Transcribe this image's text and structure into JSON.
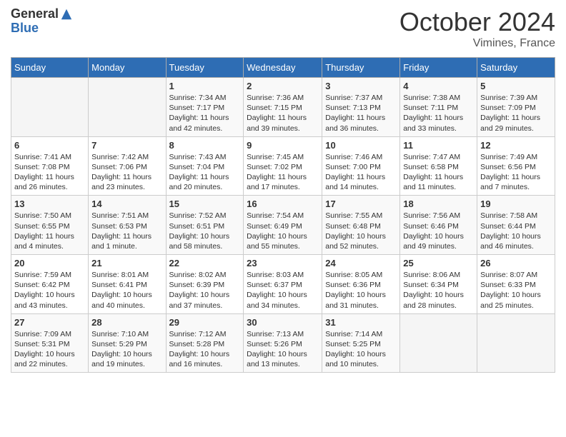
{
  "logo": {
    "general": "General",
    "blue": "Blue"
  },
  "title": "October 2024",
  "location": "Vimines, France",
  "weekdays": [
    "Sunday",
    "Monday",
    "Tuesday",
    "Wednesday",
    "Thursday",
    "Friday",
    "Saturday"
  ],
  "weeks": [
    [
      {
        "day": "",
        "info": ""
      },
      {
        "day": "",
        "info": ""
      },
      {
        "day": "1",
        "info": "Sunrise: 7:34 AM\nSunset: 7:17 PM\nDaylight: 11 hours and 42 minutes."
      },
      {
        "day": "2",
        "info": "Sunrise: 7:36 AM\nSunset: 7:15 PM\nDaylight: 11 hours and 39 minutes."
      },
      {
        "day": "3",
        "info": "Sunrise: 7:37 AM\nSunset: 7:13 PM\nDaylight: 11 hours and 36 minutes."
      },
      {
        "day": "4",
        "info": "Sunrise: 7:38 AM\nSunset: 7:11 PM\nDaylight: 11 hours and 33 minutes."
      },
      {
        "day": "5",
        "info": "Sunrise: 7:39 AM\nSunset: 7:09 PM\nDaylight: 11 hours and 29 minutes."
      }
    ],
    [
      {
        "day": "6",
        "info": "Sunrise: 7:41 AM\nSunset: 7:08 PM\nDaylight: 11 hours and 26 minutes."
      },
      {
        "day": "7",
        "info": "Sunrise: 7:42 AM\nSunset: 7:06 PM\nDaylight: 11 hours and 23 minutes."
      },
      {
        "day": "8",
        "info": "Sunrise: 7:43 AM\nSunset: 7:04 PM\nDaylight: 11 hours and 20 minutes."
      },
      {
        "day": "9",
        "info": "Sunrise: 7:45 AM\nSunset: 7:02 PM\nDaylight: 11 hours and 17 minutes."
      },
      {
        "day": "10",
        "info": "Sunrise: 7:46 AM\nSunset: 7:00 PM\nDaylight: 11 hours and 14 minutes."
      },
      {
        "day": "11",
        "info": "Sunrise: 7:47 AM\nSunset: 6:58 PM\nDaylight: 11 hours and 11 minutes."
      },
      {
        "day": "12",
        "info": "Sunrise: 7:49 AM\nSunset: 6:56 PM\nDaylight: 11 hours and 7 minutes."
      }
    ],
    [
      {
        "day": "13",
        "info": "Sunrise: 7:50 AM\nSunset: 6:55 PM\nDaylight: 11 hours and 4 minutes."
      },
      {
        "day": "14",
        "info": "Sunrise: 7:51 AM\nSunset: 6:53 PM\nDaylight: 11 hours and 1 minute."
      },
      {
        "day": "15",
        "info": "Sunrise: 7:52 AM\nSunset: 6:51 PM\nDaylight: 10 hours and 58 minutes."
      },
      {
        "day": "16",
        "info": "Sunrise: 7:54 AM\nSunset: 6:49 PM\nDaylight: 10 hours and 55 minutes."
      },
      {
        "day": "17",
        "info": "Sunrise: 7:55 AM\nSunset: 6:48 PM\nDaylight: 10 hours and 52 minutes."
      },
      {
        "day": "18",
        "info": "Sunrise: 7:56 AM\nSunset: 6:46 PM\nDaylight: 10 hours and 49 minutes."
      },
      {
        "day": "19",
        "info": "Sunrise: 7:58 AM\nSunset: 6:44 PM\nDaylight: 10 hours and 46 minutes."
      }
    ],
    [
      {
        "day": "20",
        "info": "Sunrise: 7:59 AM\nSunset: 6:42 PM\nDaylight: 10 hours and 43 minutes."
      },
      {
        "day": "21",
        "info": "Sunrise: 8:01 AM\nSunset: 6:41 PM\nDaylight: 10 hours and 40 minutes."
      },
      {
        "day": "22",
        "info": "Sunrise: 8:02 AM\nSunset: 6:39 PM\nDaylight: 10 hours and 37 minutes."
      },
      {
        "day": "23",
        "info": "Sunrise: 8:03 AM\nSunset: 6:37 PM\nDaylight: 10 hours and 34 minutes."
      },
      {
        "day": "24",
        "info": "Sunrise: 8:05 AM\nSunset: 6:36 PM\nDaylight: 10 hours and 31 minutes."
      },
      {
        "day": "25",
        "info": "Sunrise: 8:06 AM\nSunset: 6:34 PM\nDaylight: 10 hours and 28 minutes."
      },
      {
        "day": "26",
        "info": "Sunrise: 8:07 AM\nSunset: 6:33 PM\nDaylight: 10 hours and 25 minutes."
      }
    ],
    [
      {
        "day": "27",
        "info": "Sunrise: 7:09 AM\nSunset: 5:31 PM\nDaylight: 10 hours and 22 minutes."
      },
      {
        "day": "28",
        "info": "Sunrise: 7:10 AM\nSunset: 5:29 PM\nDaylight: 10 hours and 19 minutes."
      },
      {
        "day": "29",
        "info": "Sunrise: 7:12 AM\nSunset: 5:28 PM\nDaylight: 10 hours and 16 minutes."
      },
      {
        "day": "30",
        "info": "Sunrise: 7:13 AM\nSunset: 5:26 PM\nDaylight: 10 hours and 13 minutes."
      },
      {
        "day": "31",
        "info": "Sunrise: 7:14 AM\nSunset: 5:25 PM\nDaylight: 10 hours and 10 minutes."
      },
      {
        "day": "",
        "info": ""
      },
      {
        "day": "",
        "info": ""
      }
    ]
  ]
}
